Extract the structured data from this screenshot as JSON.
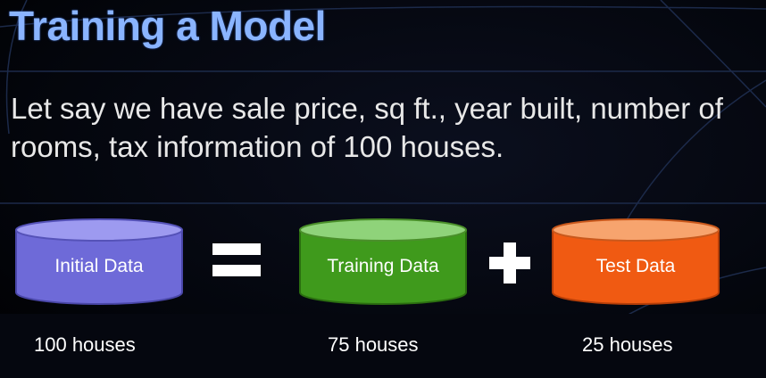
{
  "title": "Training a Model",
  "description": "Let say we have sale price, sq ft., year built, number of rooms, tax information of 100 houses.",
  "operators": {
    "equals": "=",
    "plus": "+"
  },
  "colors": {
    "initial": "#6e6ad8",
    "training": "#3f9a1c",
    "test": "#f05a12"
  },
  "datasets": [
    {
      "label": "Initial Data",
      "count": "100 houses"
    },
    {
      "label": "Training Data",
      "count": "75 houses"
    },
    {
      "label": "Test Data",
      "count": "25 houses"
    }
  ]
}
